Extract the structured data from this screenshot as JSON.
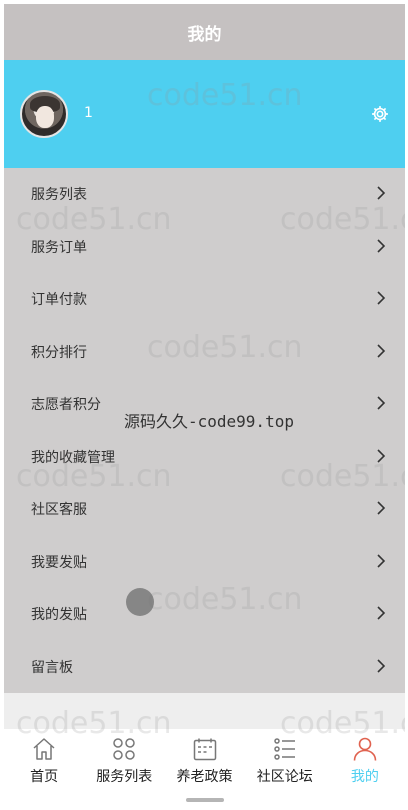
{
  "header": {
    "title": "我的"
  },
  "profile": {
    "username": "1",
    "settings_icon": "gear-icon"
  },
  "menu": {
    "items": [
      {
        "label": "服务列表"
      },
      {
        "label": "服务订单"
      },
      {
        "label": "订单付款"
      },
      {
        "label": "积分排行"
      },
      {
        "label": "志愿者积分"
      },
      {
        "label": "我的收藏管理"
      },
      {
        "label": "社区客服"
      },
      {
        "label": "我要发贴"
      },
      {
        "label": "我的发贴"
      },
      {
        "label": "留言板"
      }
    ]
  },
  "tabbar": {
    "tabs": [
      {
        "label": "首页",
        "icon": "home-icon"
      },
      {
        "label": "服务列表",
        "icon": "grid-icon"
      },
      {
        "label": "养老政策",
        "icon": "calendar-icon"
      },
      {
        "label": "社区论坛",
        "icon": "list-icon"
      },
      {
        "label": "我的",
        "icon": "user-icon",
        "active": true
      }
    ]
  },
  "overlay": {
    "center_text": "源码久久-code99.top",
    "watermark_text": "code51.cn"
  },
  "colors": {
    "accent": "#4ecff0",
    "title_bar": "#c5c1c1",
    "menu_bg": "#cfcdcd"
  }
}
